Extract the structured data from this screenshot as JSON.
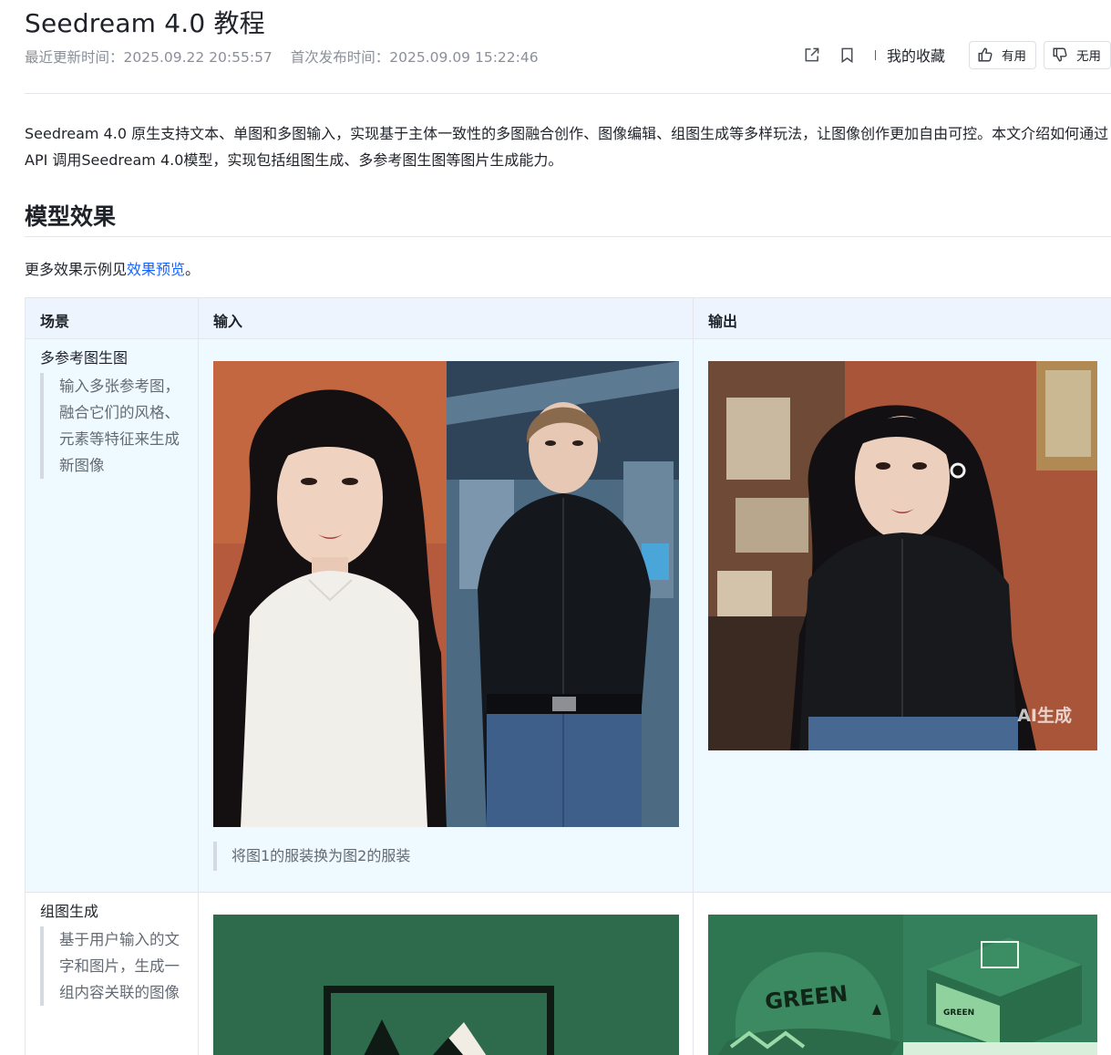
{
  "doc": {
    "title": "Seedream 4.0 教程",
    "updated": "最近更新时间：2025.09.22 20:55:57",
    "published": "首次发布时间：2025.09.09 15:22:46"
  },
  "toolbar": {
    "share_icon": "share-external-icon",
    "bookmark_icon": "bookmark-icon",
    "favorites_label": "我的收藏",
    "useful_label": "有用",
    "useless_label": "无用"
  },
  "intro": "Seedream 4.0 原生支持文本、单图和多图输入，实现基于主体一致性的多图融合创作、图像编辑、组图生成等多样玩法，让图像创作更加自由可控。本文介绍如何通过API 调用Seedream 4.0模型，实现包括组图生成、多参考图生图等图片生成能力。",
  "section": {
    "heading": "模型效果",
    "more_prefix": "更多效果示例见",
    "more_link": "效果预览",
    "more_suffix": "。"
  },
  "table": {
    "headers": [
      "场景",
      "输入",
      "输出"
    ],
    "rows": [
      {
        "scene": "多参考图生图",
        "desc": "输入多张参考图，融合它们的风格、元素等特征来生成新图像",
        "caption": "将图1的服装换为图2的服装",
        "ai_label": "AI生成"
      },
      {
        "scene": "组图生成",
        "desc": "基于用户输入的文字和图片，生成一组内容关联的图像"
      }
    ]
  },
  "colors": {
    "link": "#1664ff",
    "header_bg": "#eef4fd",
    "row_bg": "#eefaff",
    "green": "#2f6f4e"
  }
}
